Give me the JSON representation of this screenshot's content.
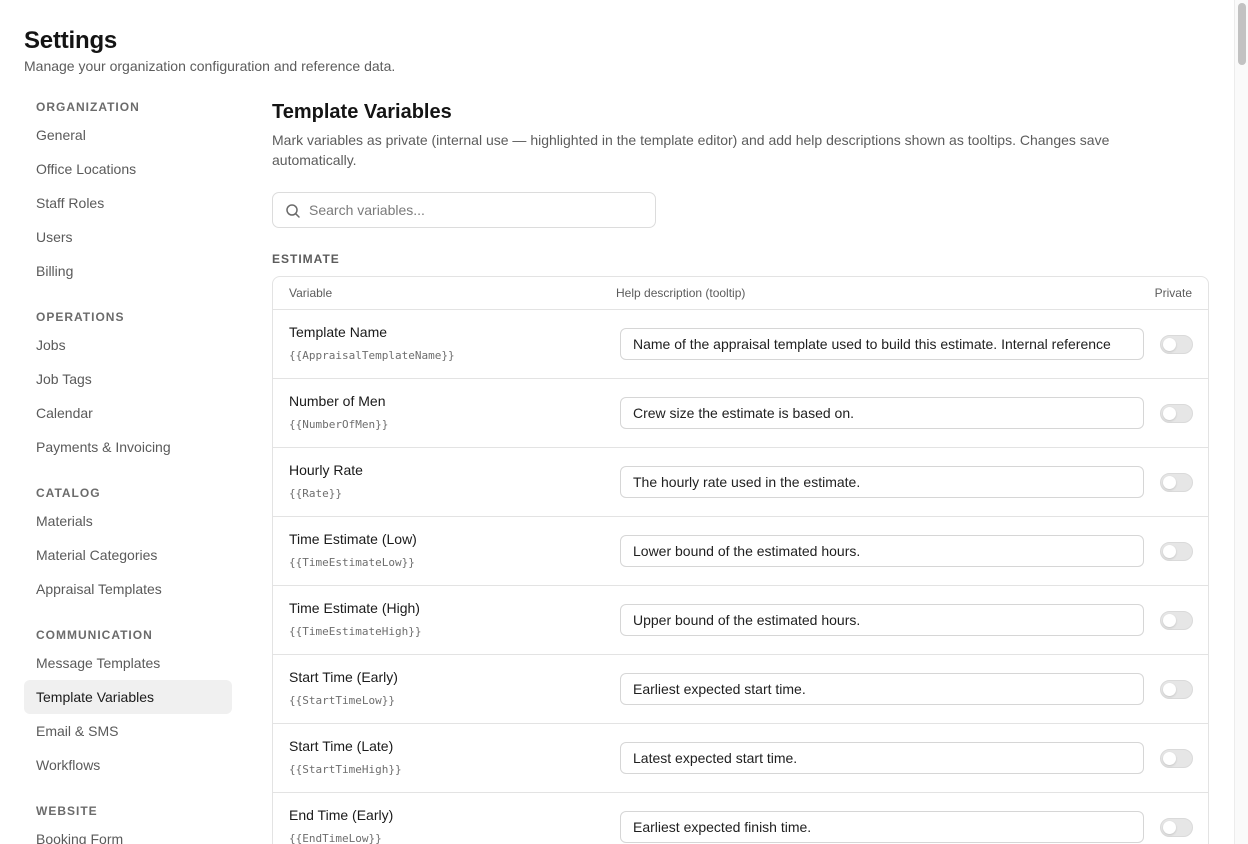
{
  "page": {
    "title": "Settings",
    "subtitle": "Manage your organization configuration and reference data."
  },
  "sidebar": {
    "sections": [
      {
        "heading": "ORGANIZATION",
        "items": [
          "General",
          "Office Locations",
          "Staff Roles",
          "Users",
          "Billing"
        ]
      },
      {
        "heading": "OPERATIONS",
        "items": [
          "Jobs",
          "Job Tags",
          "Calendar",
          "Payments & Invoicing"
        ]
      },
      {
        "heading": "CATALOG",
        "items": [
          "Materials",
          "Material Categories",
          "Appraisal Templates"
        ]
      },
      {
        "heading": "COMMUNICATION",
        "items": [
          "Message Templates",
          "Template Variables",
          "Email & SMS",
          "Workflows"
        ]
      },
      {
        "heading": "WEBSITE",
        "items": [
          "Booking Form"
        ]
      }
    ],
    "active_item": "Template Variables"
  },
  "main": {
    "title": "Template Variables",
    "description": "Mark variables as private (internal use — highlighted in the template editor) and add help descriptions shown as tooltips. Changes save automatically.",
    "search": {
      "placeholder": "Search variables...",
      "icon": "search-icon"
    },
    "group_label": "ESTIMATE",
    "table": {
      "headers": {
        "variable": "Variable",
        "description": "Help description (tooltip)",
        "private": "Private"
      },
      "rows": [
        {
          "name": "Template Name",
          "token": "{{AppraisalTemplateName}}",
          "description": "Name of the appraisal template used to build this estimate. Internal reference",
          "private": false
        },
        {
          "name": "Number of Men",
          "token": "{{NumberOfMen}}",
          "description": "Crew size the estimate is based on.",
          "private": false
        },
        {
          "name": "Hourly Rate",
          "token": "{{Rate}}",
          "description": "The hourly rate used in the estimate.",
          "private": false
        },
        {
          "name": "Time Estimate (Low)",
          "token": "{{TimeEstimateLow}}",
          "description": "Lower bound of the estimated hours.",
          "private": false
        },
        {
          "name": "Time Estimate (High)",
          "token": "{{TimeEstimateHigh}}",
          "description": "Upper bound of the estimated hours.",
          "private": false
        },
        {
          "name": "Start Time (Early)",
          "token": "{{StartTimeLow}}",
          "description": "Earliest expected start time.",
          "private": false
        },
        {
          "name": "Start Time (Late)",
          "token": "{{StartTimeHigh}}",
          "description": "Latest expected start time.",
          "private": false
        },
        {
          "name": "End Time (Early)",
          "token": "{{EndTimeLow}}",
          "description": "Earliest expected finish time.",
          "private": false
        }
      ]
    }
  },
  "colors": {
    "active_bg": "#f0f0f0",
    "toggle_off": "#e6e6e6",
    "border": "#e3e3e3"
  }
}
